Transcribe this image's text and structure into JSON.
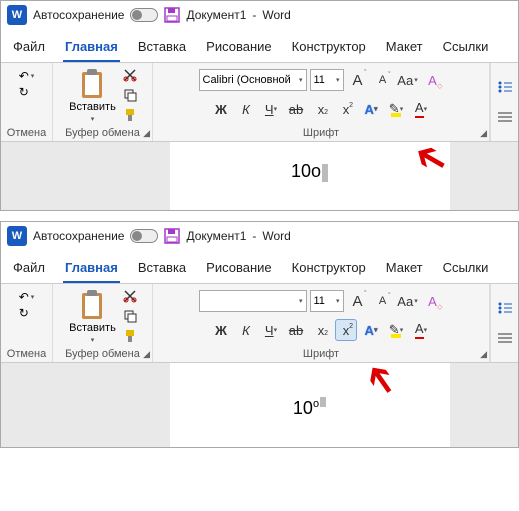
{
  "titlebar": {
    "autosave": "Автосохранение",
    "doc": "Документ1",
    "app": "Word",
    "sep": " - "
  },
  "tabs": {
    "file": "Файл",
    "home": "Главная",
    "insert": "Вставка",
    "draw": "Рисование",
    "design": "Конструктор",
    "layout": "Макет",
    "refs": "Ссылки"
  },
  "groups": {
    "undo": "Отмена",
    "clipboard": "Буфер обмена",
    "font": "Шрифт",
    "paste": "Вставить"
  },
  "font": {
    "name": "Calibri (Основной",
    "size": "11",
    "bold": "Ж",
    "italic": "К",
    "underline": "Ч",
    "strike": "ab",
    "sub": "x",
    "sup": "x",
    "A": "A",
    "Aa": "Aa"
  },
  "doc1": {
    "text": "10о"
  },
  "doc2": {
    "text_base": "10",
    "text_sup": "о"
  }
}
